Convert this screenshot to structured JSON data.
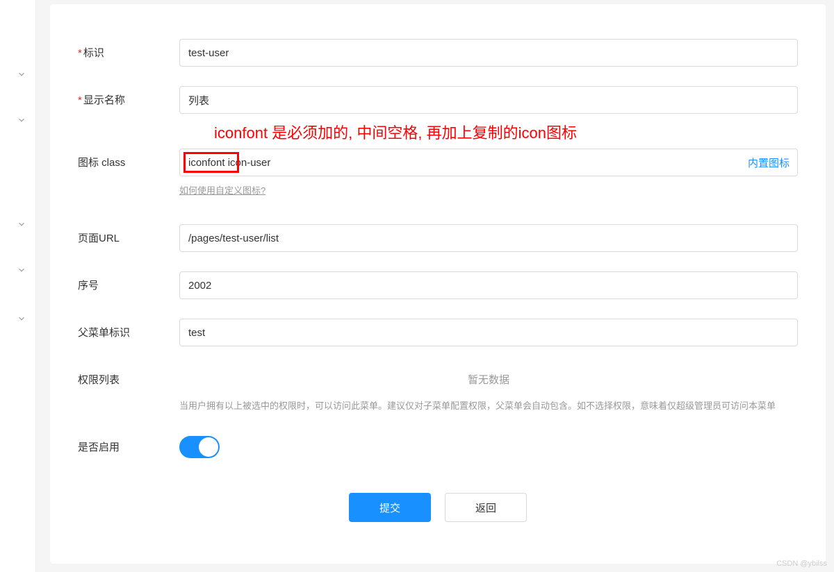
{
  "form": {
    "identifier": {
      "label": "标识",
      "value": "test-user",
      "required": true
    },
    "displayName": {
      "label": "显示名称",
      "value": "列表",
      "required": true
    },
    "iconClass": {
      "label": "图标 class",
      "value": "iconfont icon-user",
      "builtInLink": "内置图标",
      "helpLink": "如何使用自定义图标?"
    },
    "pageUrl": {
      "label": "页面URL",
      "value": "/pages/test-user/list"
    },
    "sort": {
      "label": "序号",
      "value": "2002"
    },
    "parentMenu": {
      "label": "父菜单标识",
      "value": "test"
    },
    "permissions": {
      "label": "权限列表",
      "emptyText": "暂无数据",
      "helpText": "当用户拥有以上被选中的权限时，可以访问此菜单。建议仅对子菜单配置权限，父菜单会自动包含。如不选择权限，意味着仅超级管理员可访问本菜单"
    },
    "enabled": {
      "label": "是否启用",
      "value": true
    }
  },
  "annotation": "iconfont 是必须加的, 中间空格, 再加上复制的icon图标",
  "buttons": {
    "submit": "提交",
    "back": "返回"
  },
  "watermark": "CSDN @ybilss"
}
